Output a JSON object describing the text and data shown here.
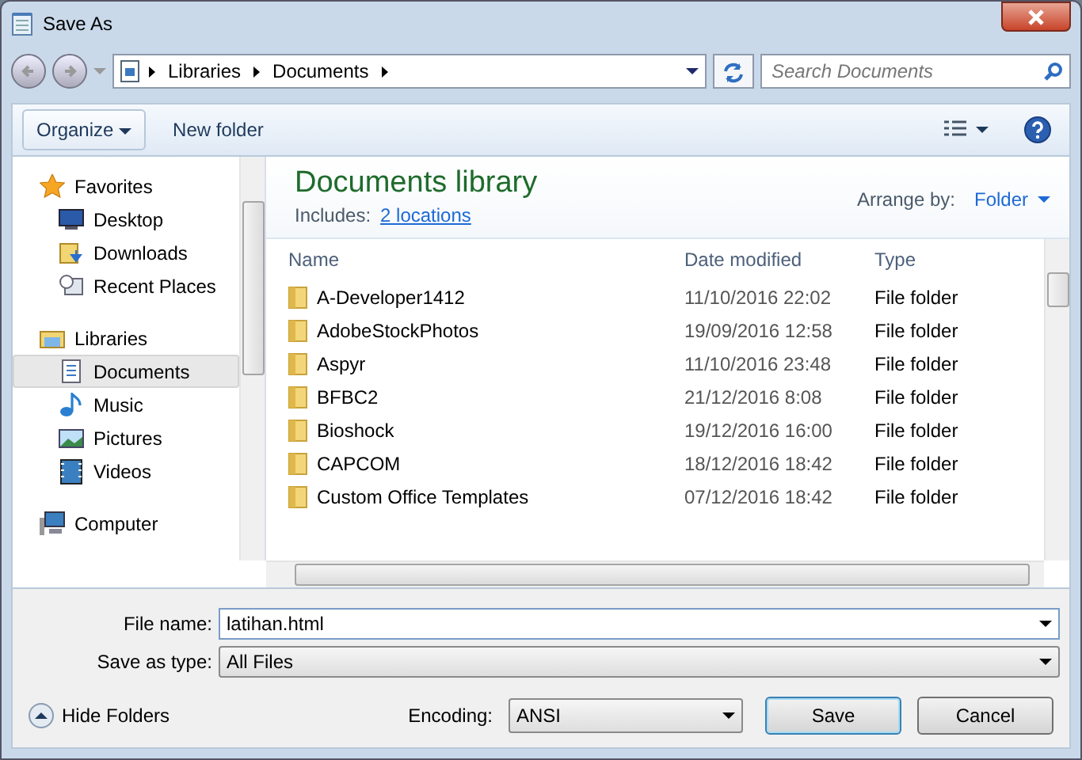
{
  "window": {
    "title": "Save As"
  },
  "address": {
    "path": [
      "Libraries",
      "Documents"
    ],
    "search_placeholder": "Search Documents"
  },
  "toolbar": {
    "organize": "Organize",
    "new_folder": "New folder"
  },
  "sidebar": {
    "items": [
      {
        "label": "Favorites",
        "selected": false,
        "children": [
          {
            "label": "Desktop",
            "selected": false
          },
          {
            "label": "Downloads",
            "selected": false
          },
          {
            "label": "Recent Places",
            "selected": false
          }
        ]
      },
      {
        "label": "Libraries",
        "selected": false,
        "children": [
          {
            "label": "Documents",
            "selected": true
          },
          {
            "label": "Music",
            "selected": false
          },
          {
            "label": "Pictures",
            "selected": false
          },
          {
            "label": "Videos",
            "selected": false
          }
        ]
      },
      {
        "label": "Computer",
        "selected": false
      }
    ]
  },
  "library": {
    "title": "Documents library",
    "includes_label": "Includes:",
    "includes_link": "2 locations",
    "arrange_label": "Arrange by:",
    "arrange_value": "Folder"
  },
  "table": {
    "columns": [
      "Name",
      "Date modified",
      "Type"
    ],
    "rows": [
      [
        "A-Developer1412",
        "11/10/2016 22:02",
        "File folder"
      ],
      [
        "AdobeStockPhotos",
        "19/09/2016 12:58",
        "File folder"
      ],
      [
        "Aspyr",
        "11/10/2016 23:48",
        "File folder"
      ],
      [
        "BFBC2",
        "21/12/2016 8:08",
        "File folder"
      ],
      [
        "Bioshock",
        "19/12/2016 16:00",
        "File folder"
      ],
      [
        "CAPCOM",
        "18/12/2016 18:42",
        "File folder"
      ],
      [
        "Custom Office Templates",
        "07/12/2016 18:42",
        "File folder"
      ]
    ]
  },
  "form": {
    "file_name_label": "File name:",
    "file_name": "latihan.html",
    "type_label": "Save as type:",
    "type": "All Files"
  },
  "footer": {
    "hide_folders": "Hide Folders",
    "encoding_label": "Encoding:",
    "encoding": "ANSI",
    "save": "Save",
    "cancel": "Cancel"
  }
}
